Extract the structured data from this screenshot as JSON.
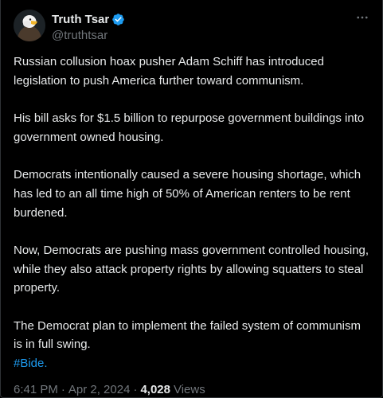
{
  "author": {
    "display_name": "Truth Tsar",
    "handle": "@truthtsar",
    "verified": true,
    "avatar_icon": "eagle-avatar-icon"
  },
  "menu_icon": "more-horizontal-icon",
  "paragraphs": [
    "Russian collusion hoax pusher Adam Schiff has introduced legislation to push America further toward communism.",
    "His bill asks for $1.5 billion to repurpose government buildings into government owned housing.",
    "Democrats intentionally caused a severe housing shortage, which has led to an all time high of 50% of American renters to be rent burdened.",
    "Now, Democrats are pushing mass government controlled housing, while they also attack property rights by allowing squatters to steal property."
  ],
  "last_paragraph": "The Democrat plan to implement the failed system of communism is in full swing.",
  "hashtag": "#Bide.",
  "meta": {
    "time": "6:41 PM",
    "separator": "·",
    "date": "Apr 2, 2024",
    "views_count": "4,028",
    "views_label": "Views"
  },
  "colors": {
    "background": "#000000",
    "text": "#e7e9ea",
    "secondary_text": "#71767b",
    "link": "#1d9bf0",
    "verified_badge": "#1d9bf0"
  }
}
